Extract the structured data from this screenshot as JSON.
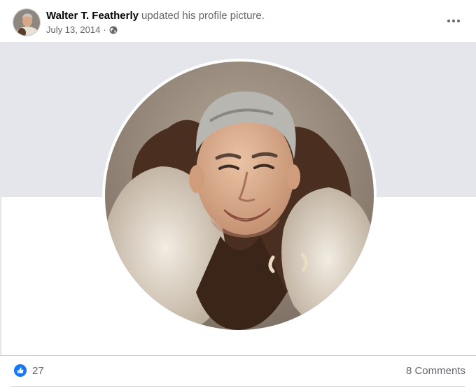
{
  "post": {
    "author": "Walter T. Featherly",
    "action": "updated his profile picture.",
    "date": "July 13, 2014",
    "separator": "·"
  },
  "icons": {
    "privacy": "globe-icon",
    "more": "more-horizontal-icon",
    "reaction": "like-icon"
  },
  "colors": {
    "like_blue": "#1877f2",
    "secondary_text": "#65676b",
    "cover_band": "#e4e6eb"
  },
  "footer": {
    "like_count": "27",
    "comments_label": "8 Comments"
  }
}
